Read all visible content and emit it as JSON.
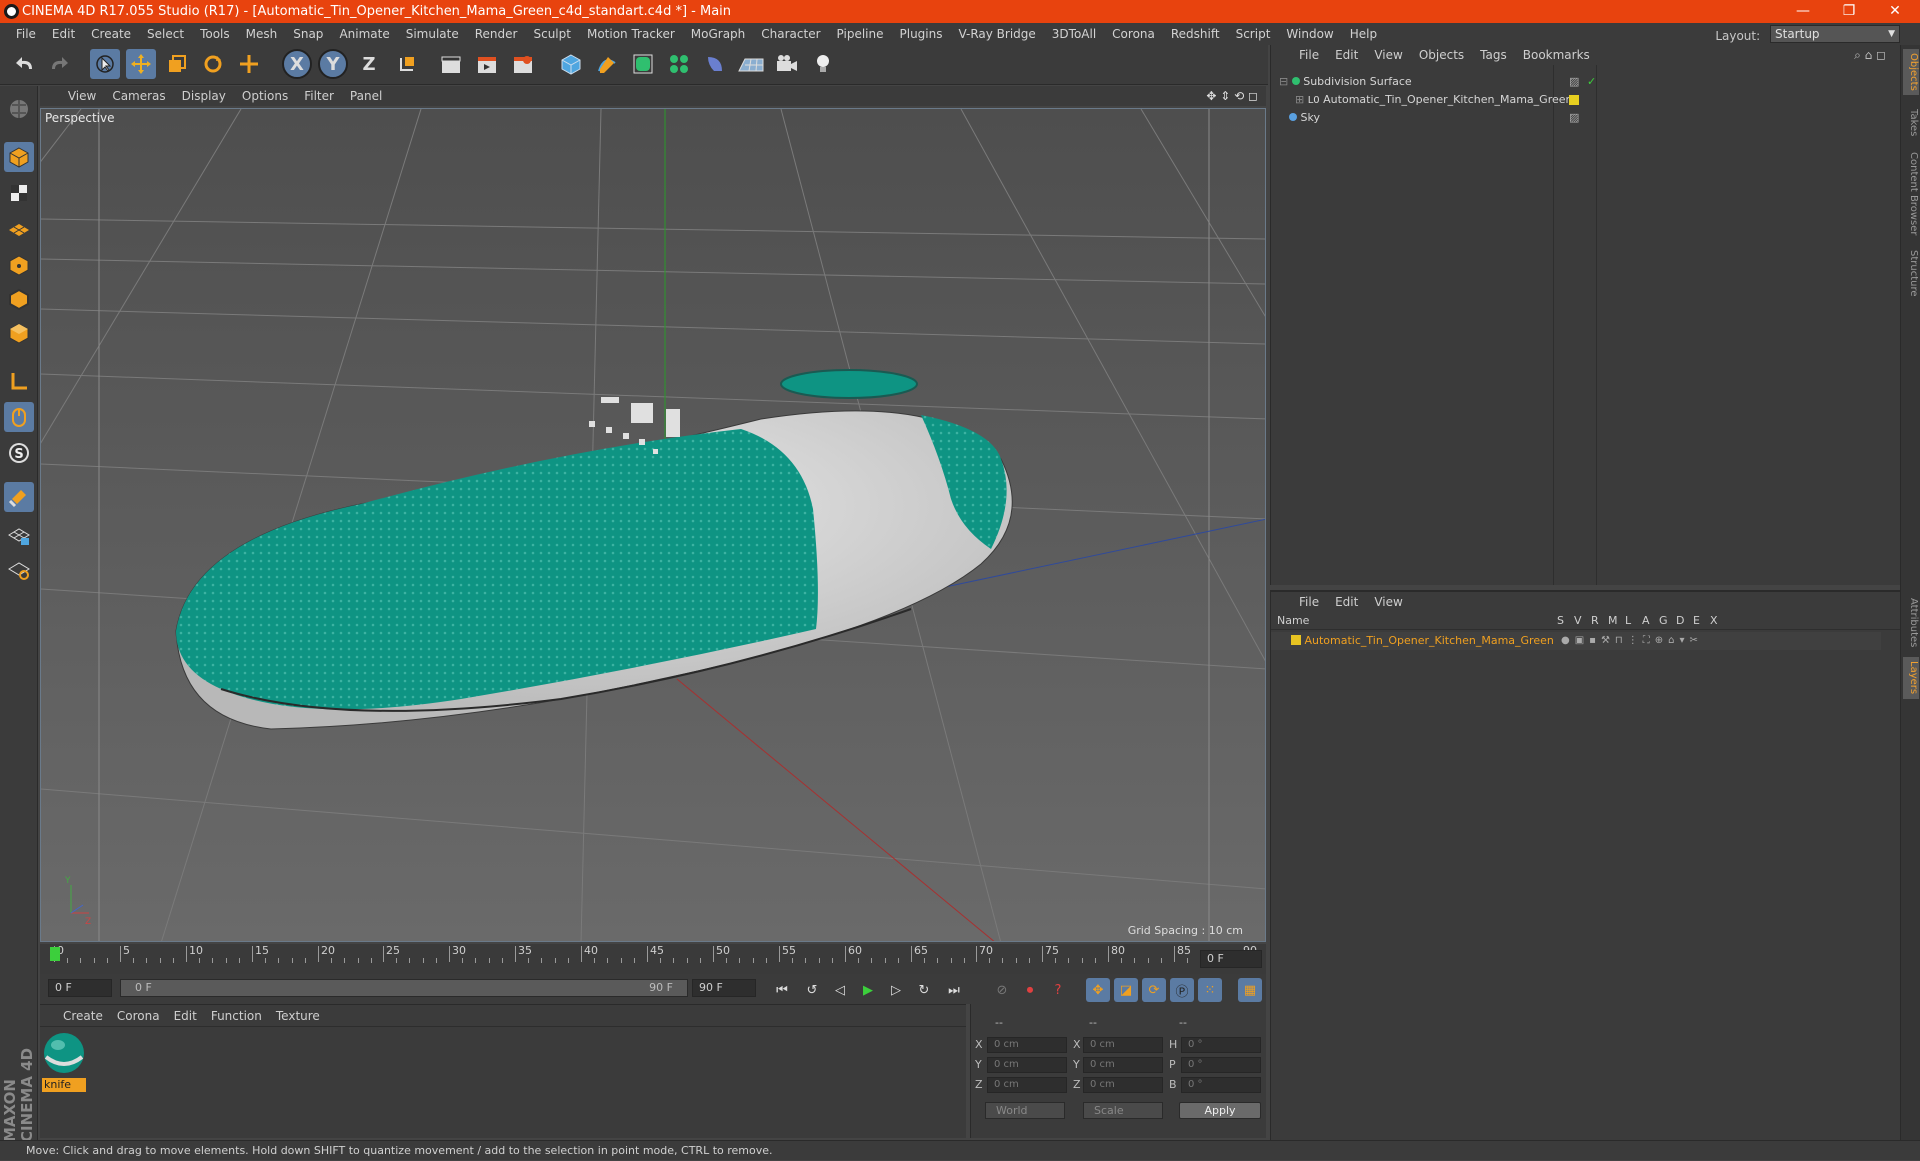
{
  "window": {
    "title": "CINEMA 4D R17.055 Studio (R17) - [Automatic_Tin_Opener_Kitchen_Mama_Green_c4d_standart.c4d *] - Main",
    "minimize": "—",
    "maximize": "❐",
    "close": "✕"
  },
  "menubar": {
    "items": [
      "File",
      "Edit",
      "Create",
      "Select",
      "Tools",
      "Mesh",
      "Snap",
      "Animate",
      "Simulate",
      "Render",
      "Sculpt",
      "Motion Tracker",
      "MoGraph",
      "Character",
      "Pipeline",
      "Plugins",
      "V-Ray Bridge",
      "3DToAll",
      "Corona",
      "Redshift",
      "Script",
      "Window",
      "Help"
    ],
    "layout_label": "Layout:",
    "layout_value": "Startup"
  },
  "toolbar": {
    "axis_x": "X",
    "axis_y": "Y",
    "axis_z": "Z"
  },
  "viewport": {
    "menu": [
      "View",
      "Cameras",
      "Display",
      "Options",
      "Filter",
      "Panel"
    ],
    "label": "Perspective",
    "grid_spacing": "Grid Spacing : 10 cm",
    "model_colors": {
      "primary": "#0e9483",
      "secondary": "#d8d8d8"
    }
  },
  "timeline": {
    "ticks": [
      "0",
      "5",
      "10",
      "15",
      "20",
      "25",
      "30",
      "35",
      "40",
      "45",
      "50",
      "55",
      "60",
      "65",
      "70",
      "75",
      "80",
      "85",
      "90"
    ],
    "current_frame": "0 F",
    "start_field": "0 F",
    "range_start": "0 F",
    "range_end": "90 F",
    "end_field": "90 F"
  },
  "material_panel": {
    "menu": [
      "Create",
      "Corona",
      "Edit",
      "Function",
      "Texture"
    ],
    "material_name": "knife"
  },
  "coords": {
    "header": [
      "--",
      "--",
      "--"
    ],
    "rows": [
      {
        "a": "X",
        "av": "0 cm",
        "b": "X",
        "bv": "0 cm",
        "c": "H",
        "cv": "0 °"
      },
      {
        "a": "Y",
        "av": "0 cm",
        "b": "Y",
        "bv": "0 cm",
        "c": "P",
        "cv": "0 °"
      },
      {
        "a": "Z",
        "av": "0 cm",
        "b": "Z",
        "bv": "0 cm",
        "c": "B",
        "cv": "0 °"
      }
    ],
    "world": "World",
    "scale": "Scale",
    "apply": "Apply"
  },
  "object_manager": {
    "menu": [
      "File",
      "Edit",
      "View",
      "Objects",
      "Tags",
      "Bookmarks"
    ],
    "objects": [
      {
        "name": "Subdivision Surface"
      },
      {
        "name": "Automatic_Tin_Opener_Kitchen_Mama_Green"
      },
      {
        "name": "Sky"
      }
    ]
  },
  "layer_manager": {
    "menu": [
      "File",
      "Edit",
      "View"
    ],
    "columns": [
      "Name",
      "S",
      "V",
      "R",
      "M",
      "L",
      "A",
      "G",
      "D",
      "E",
      "X"
    ],
    "layers": [
      {
        "name": "Automatic_Tin_Opener_Kitchen_Mama_Green",
        "color": "#e8c422"
      }
    ]
  },
  "side_tabs": [
    "Objects",
    "Takes",
    "Content Browser",
    "Structure",
    "Attributes",
    "Layers"
  ],
  "brand": "MAXON CINEMA 4D",
  "status": "Move: Click and drag to move elements. Hold down SHIFT to quantize movement / add to the selection in point mode, CTRL to remove."
}
